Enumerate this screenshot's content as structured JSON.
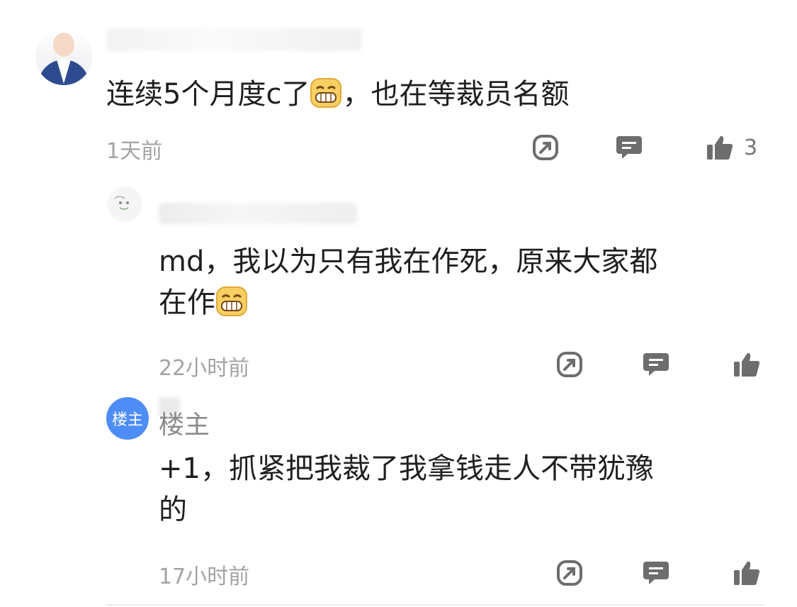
{
  "comment": {
    "text_before_emoji": "连续5个月度c了",
    "text_after_emoji": "，也在等裁员名额",
    "time": "1天前",
    "likes": "3"
  },
  "replies": [
    {
      "text_line1": "md，我以为只有我在作死，原来大家都",
      "text_line2": "在作",
      "time": "22小时前"
    },
    {
      "badge": "楼主",
      "author": "楼主",
      "text_line1": "+1，抓紧把我裁了我拿钱走人不带犹豫",
      "text_line2": "的",
      "time": "17小时前"
    }
  ],
  "icons": [
    "share-icon",
    "reply-icon",
    "like-icon",
    "grin-emoji-icon"
  ],
  "colors": {
    "text": "#1f1f1f",
    "muted": "#a3a3a3",
    "icon": "#6d6d6d",
    "badge": "#4e8df6"
  }
}
